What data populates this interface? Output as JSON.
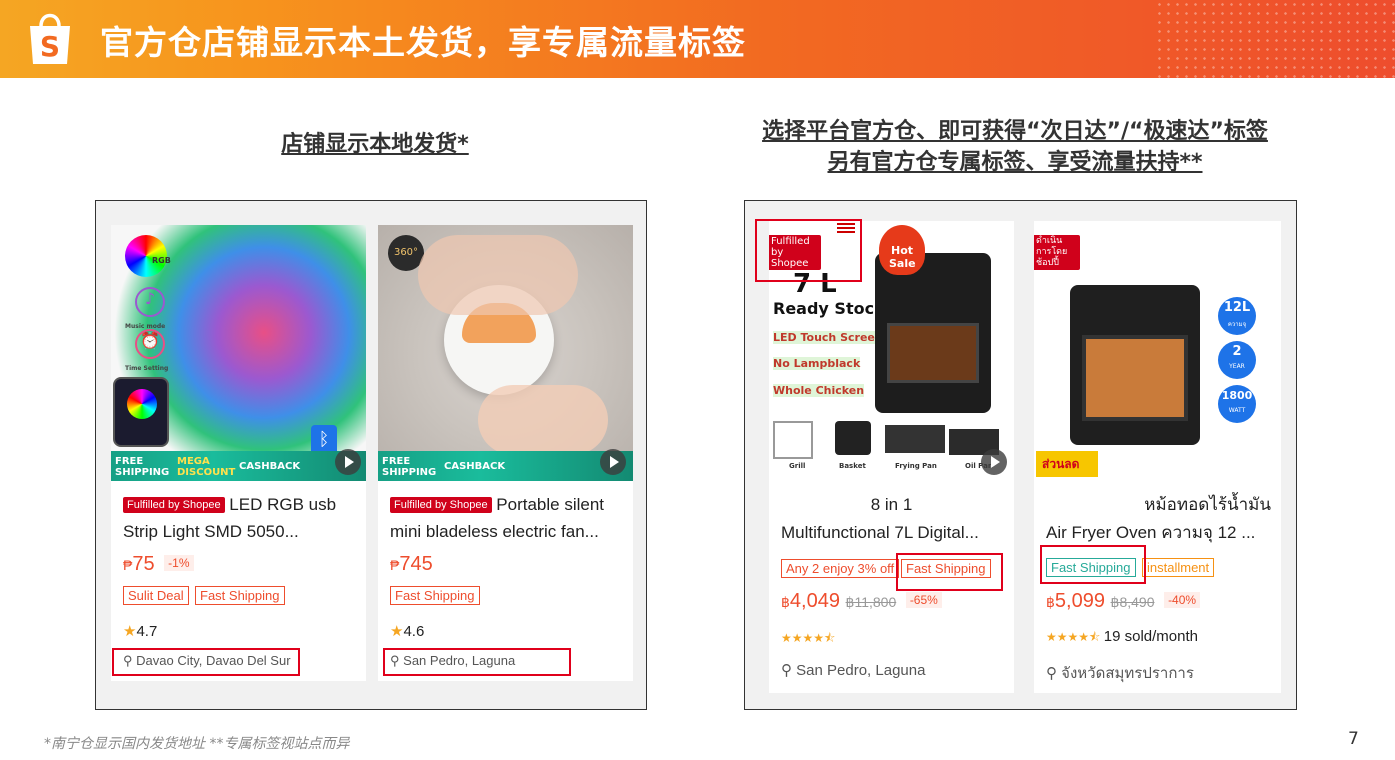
{
  "banner": {
    "title": "官方仓店铺显示本土发货，享专属流量标签",
    "accent": "#ee4d2d",
    "logo_letter": "S"
  },
  "left_section": {
    "title": "店铺显示本地发货*",
    "products": [
      {
        "badge": "Fulfilled by Shopee",
        "name_line1": "LED RGB usb",
        "name_line2": "Strip Light SMD 5050...",
        "currency": "₱",
        "price": "75",
        "discount": "-1%",
        "tags": [
          "Sulit Deal",
          "Fast Shipping"
        ],
        "rating": "4.7",
        "location": "Davao City, Davao Del Sur",
        "img_labels": {
          "rgb": "RGB",
          "music": "Music mode",
          "time": "Time Setting",
          "promo1": "FREE SHIPPING",
          "promo2": "MEGA DISCOUNT",
          "promo3": "CASHBACK",
          "bt": "Bluetooth"
        }
      },
      {
        "badge": "Fulfilled by Shopee",
        "name_line1": "Portable silent",
        "name_line2": "mini bladeless electric fan...",
        "currency": "₱",
        "price": "745",
        "tags": [
          "Fast Shipping"
        ],
        "rating": "4.6",
        "location": "San Pedro, Laguna",
        "img_labels": {
          "deg": "360°",
          "promo1": "FREE SHIPPING",
          "promo3": "CASHBACK"
        }
      }
    ]
  },
  "right_section": {
    "title_line1": "选择平台官方仓、即可获得“次日达”/“极速达”标签",
    "title_line2": "另有官方仓专属标签、享受流量扶持**",
    "products": [
      {
        "badge": "Fulfilled by Shopee",
        "img_labels": {
          "size": "7 L",
          "ready": "Ready Stock",
          "f1": "LED Touch Screen",
          "f2": "No Lampblack",
          "f3": "Whole Chicken",
          "hot1": "Hot",
          "hot2": "Sale",
          "a1": "Grill",
          "a2": "Basket",
          "a3": "Frying Pan",
          "a4": "Oil Pan"
        },
        "name_line1": "8 in 1",
        "name_line2": "Multifunctional 7L Digital...",
        "tags": [
          "Any 2 enjoy 3% off",
          "Fast Shipping"
        ],
        "currency": "฿",
        "price": "4,049",
        "old_price": "฿11,800",
        "discount": "-65%",
        "stars": "★★★★⯪",
        "sold": "",
        "location": "San Pedro, Laguna"
      },
      {
        "badge": "ดำเนินการโดยช้อปปี้",
        "img_labels": {
          "cap": "12L",
          "cap_sub": "ความจุ",
          "year": "2",
          "year_sub": "YEAR",
          "watt": "1800",
          "watt_sub": "WATT",
          "promo": "ส่วนลด"
        },
        "name_line1": "หม้อทอดไร้น้ำมัน",
        "name_line2": "Air Fryer Oven ความจุ 12 ...",
        "tags": [
          "Fast Shipping",
          "installment"
        ],
        "currency": "฿",
        "price": "5,099",
        "old_price": "฿8,490",
        "discount": "-40%",
        "stars": "★★★★⯪",
        "sold": "19 sold/month",
        "location": "จังหวัดสมุทรปราการ"
      }
    ]
  },
  "footnote": "*南宁仓显示国内发货地址  **专属标签视站点而异",
  "page_number": "7"
}
